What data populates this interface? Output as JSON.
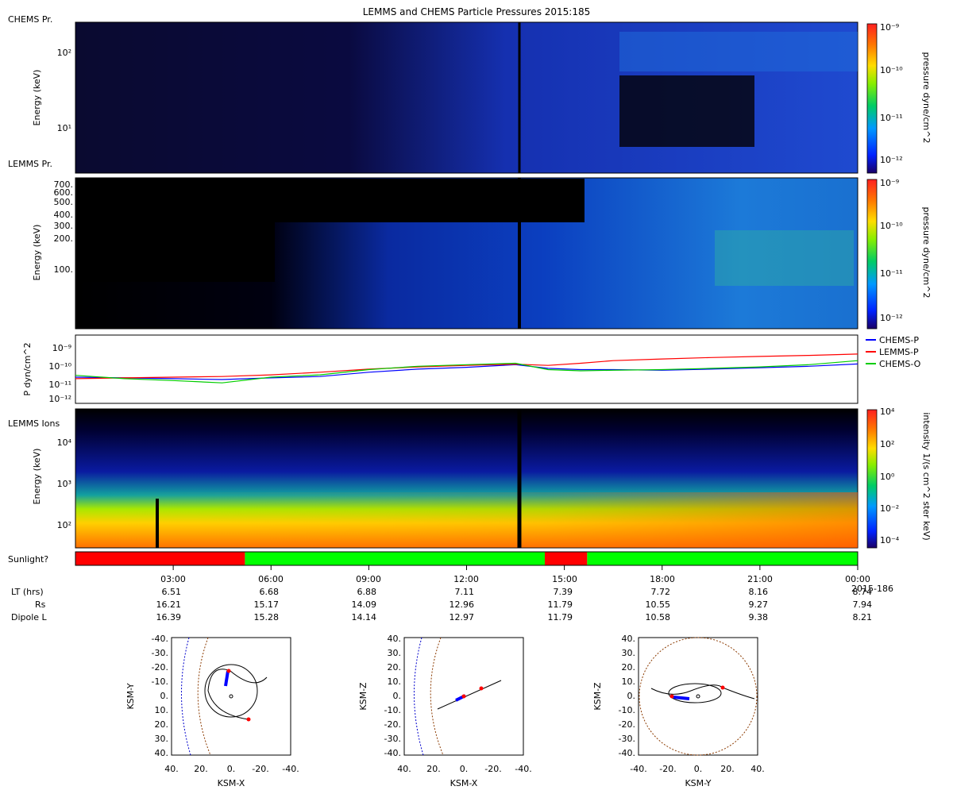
{
  "title": "LEMMS and CHEMS Particle Pressures  2015:185",
  "panels": {
    "chems": {
      "tag": "CHEMS Pr.",
      "ylabel": "Energy (keV)",
      "yticks": [
        "10²",
        "10¹"
      ],
      "cbar_label": "pressure dyne/cm^2",
      "cbar_ticks": [
        "10⁻⁹",
        "10⁻¹⁰",
        "10⁻¹¹",
        "10⁻¹²"
      ]
    },
    "lemms_pr": {
      "tag": "LEMMS Pr.",
      "ylabel": "Energy (keV)",
      "yticks": [
        "700.",
        "600.",
        "500.",
        "400.",
        "300.",
        "200.",
        "100."
      ],
      "cbar_label": "pressure dyne/cm^2",
      "cbar_ticks": [
        "10⁻⁹",
        "10⁻¹⁰",
        "10⁻¹¹",
        "10⁻¹²"
      ]
    },
    "pressure": {
      "ylabel": "P dyn/cm^2",
      "yticks": [
        "10⁻⁹",
        "10⁻¹⁰",
        "10⁻¹¹",
        "10⁻¹²"
      ]
    },
    "lemms_ions": {
      "tag": "LEMMS Ions",
      "ylabel": "Energy (keV)",
      "yticks": [
        "10⁴",
        "10³",
        "10²"
      ],
      "cbar_label": "intensity 1/(s cm^2 ster keV)",
      "cbar_ticks": [
        "10⁴",
        "10²",
        "10⁰",
        "10⁻²",
        "10⁻⁴"
      ]
    },
    "sunlight": {
      "label": "Sunlight?",
      "segments": [
        {
          "start": 0.0,
          "end": 5.2,
          "lit": false
        },
        {
          "start": 5.2,
          "end": 14.4,
          "lit": true
        },
        {
          "start": 14.4,
          "end": 15.7,
          "lit": false
        },
        {
          "start": 15.7,
          "end": 24.0,
          "lit": true
        }
      ],
      "colors": {
        "lit": "#00ff00",
        "dark": "#ff0000"
      }
    }
  },
  "time_axis": {
    "ticks": [
      "03:00",
      "06:00",
      "09:00",
      "12:00",
      "15:00",
      "18:00",
      "21:00",
      "00:00"
    ],
    "end_date": "2015-186",
    "rows": [
      {
        "label": "LT (hrs)",
        "values": [
          "6.51",
          "6.68",
          "6.88",
          "7.11",
          "7.39",
          "7.72",
          "8.16",
          "8.74"
        ]
      },
      {
        "label": "Rs",
        "values": [
          "16.21",
          "15.17",
          "14.09",
          "12.96",
          "11.79",
          "10.55",
          "9.27",
          "7.94"
        ]
      },
      {
        "label": "Dipole L",
        "values": [
          "16.39",
          "15.28",
          "14.14",
          "12.97",
          "11.79",
          "10.58",
          "9.38",
          "8.21"
        ]
      }
    ]
  },
  "orbit_plots": [
    {
      "xlabel": "KSM-X",
      "ylabel": "KSM-Y",
      "xticks": [
        "40.",
        "20.",
        "0.",
        "-20.",
        "-40."
      ],
      "yticks": [
        "-40.",
        "-30.",
        "-20.",
        "-10.",
        "0.",
        "10.",
        "20.",
        "30.",
        "40."
      ]
    },
    {
      "xlabel": "KSM-X",
      "ylabel": "KSM-Z",
      "xticks": [
        "40.",
        "20.",
        "0.",
        "-20.",
        "-40."
      ],
      "yticks": [
        "40.",
        "30.",
        "20.",
        "10.",
        "0.",
        "-10.",
        "-20.",
        "-30.",
        "-40."
      ]
    },
    {
      "xlabel": "KSM-Y",
      "ylabel": "KSM-Z",
      "xticks": [
        "-40.",
        "-20.",
        "0.",
        "20.",
        "40."
      ],
      "yticks": [
        "40.",
        "30.",
        "20.",
        "10.",
        "0.",
        "-10.",
        "-20.",
        "-30.",
        "-40."
      ]
    }
  ],
  "chart_data": {
    "type": "line",
    "title": "LEMMS and CHEMS Particle Pressures  2015:185",
    "xlabel": "",
    "ylabel": "P dyn/cm^2",
    "log_y": true,
    "ylim": [
      5e-13,
      2e-09
    ],
    "x_hours": [
      0,
      1.5,
      3,
      4.5,
      6,
      7.5,
      9,
      10.5,
      12,
      13.5,
      14.5,
      15.5,
      16.5,
      18,
      19.5,
      21,
      22.5,
      24
    ],
    "legend_position": "right",
    "series": [
      {
        "name": "CHEMS-P",
        "color": "#0000ff",
        "values": [
          1.2e-11,
          1.1e-11,
          1e-11,
          9e-12,
          1.1e-11,
          1.3e-11,
          2.2e-11,
          3.2e-11,
          4e-11,
          5.5e-11,
          3.5e-11,
          3e-11,
          3e-11,
          2.8e-11,
          3.2e-11,
          3.8e-11,
          4.5e-11,
          6e-11
        ]
      },
      {
        "name": "LEMMS-P",
        "color": "#ff0000",
        "values": [
          1e-11,
          1.1e-11,
          1.2e-11,
          1.3e-11,
          1.6e-11,
          2.2e-11,
          3.2e-11,
          4.2e-11,
          5e-11,
          5.8e-11,
          5e-11,
          6.5e-11,
          9e-11,
          1.1e-10,
          1.3e-10,
          1.5e-10,
          1.7e-10,
          2e-10
        ]
      },
      {
        "name": "CHEMS-O",
        "color": "#00cc00",
        "values": [
          1.5e-11,
          1e-11,
          8e-12,
          6e-12,
          1.2e-11,
          1.6e-11,
          3e-11,
          4.5e-11,
          5.5e-11,
          6.5e-11,
          3e-11,
          2.6e-11,
          2.8e-11,
          3e-11,
          3.5e-11,
          4.2e-11,
          5.5e-11,
          9e-11
        ]
      }
    ]
  }
}
